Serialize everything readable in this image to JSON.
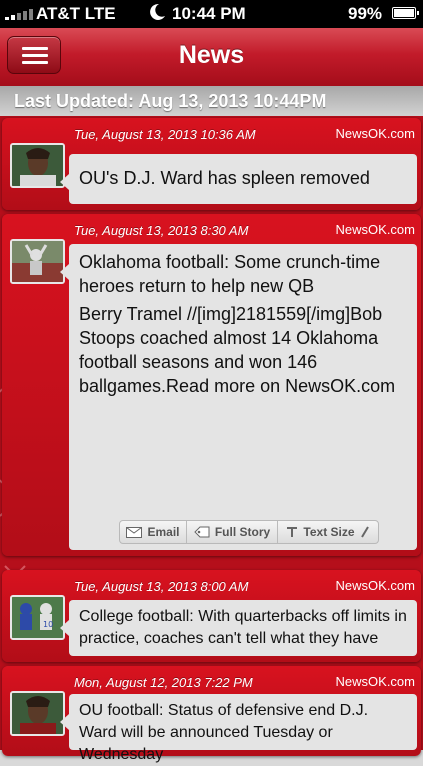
{
  "status_bar": {
    "carrier": "AT&T  LTE",
    "time": "10:44 PM",
    "battery": "99%"
  },
  "header": {
    "title": "News",
    "menu_icon": "hamburger-menu-icon"
  },
  "last_updated": "Last Updated: Aug 13, 2013 10:44PM",
  "news": [
    {
      "date": "Tue, August 13, 2013 10:36 AM",
      "source": "NewsOK.com",
      "headline": "OU's D.J. Ward has spleen removed"
    },
    {
      "date": "Tue, August 13, 2013 8:30 AM",
      "source": "NewsOK.com",
      "headline": "Oklahoma football: Some crunch-time heroes return to help new QB",
      "summary": "Berry Tramel  //[img]2181559[/img]Bob Stoops coached almost 14 Oklahoma football seasons and won 146 ballgames.Read more on NewsOK.com",
      "actions": {
        "email": "Email",
        "full_story": "Full Story",
        "text_size": "Text Size"
      }
    },
    {
      "date": "Tue, August 13, 2013 8:00 AM",
      "source": "NewsOK.com",
      "headline": "College football: With quarterbacks off limits in practice, coaches can't tell what they have"
    },
    {
      "date": "Mon, August 12, 2013 7:22 PM",
      "source": "NewsOK.com",
      "headline": "OU football: Status of defensive end D.J. Ward will be announced Tuesday or Wednesday"
    }
  ]
}
